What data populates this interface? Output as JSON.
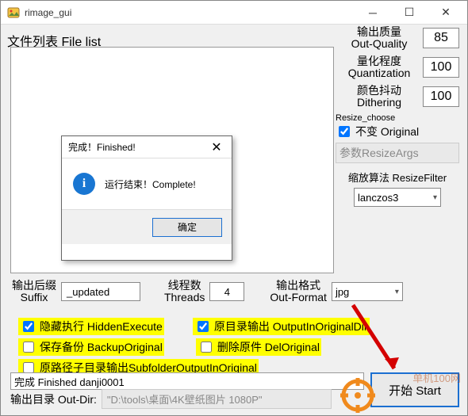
{
  "window": {
    "title": "rimage_gui"
  },
  "labels": {
    "file_list": "文件列表 File list",
    "out_quality": "输出质量\nOut-Quality",
    "quantization": "量化程度\nQuantization",
    "dithering": "颜色抖动\nDithering",
    "resize_choose": "Resize_choose",
    "original": "不变 Original",
    "resize_args": "参数ResizeArgs",
    "resize_filter": "缩放算法 ResizeFilter",
    "suffix": "输出后缀\nSuffix",
    "threads": "线程数\nThreads",
    "out_format": "输出格式\nOut-Format",
    "out_dir": "输出目录 Out-Dir:"
  },
  "values": {
    "quality": "85",
    "quantization": "100",
    "dithering": "100",
    "filter": "lanczos3",
    "suffix": "_updated",
    "threads": "4",
    "format": "jpg",
    "status": "完成 Finished  danji0001",
    "outdir_path": "\"D:\\tools\\桌面\\4K壁纸图片 1080P\""
  },
  "checks": {
    "hidden_execute": "隐藏执行 HiddenExecute",
    "output_in_original_dir": "原目录输出 OutputInOriginalDir",
    "backup_original": "保存备份 BackupOriginal",
    "del_original": "删除原件 DelOriginal",
    "subfolder_output": "原路径子目录输出SubfolderOutputInOriginal"
  },
  "buttons": {
    "start": "开始 Start",
    "ok": "确定"
  },
  "dialog": {
    "title": "完成！Finished!",
    "message": "运行结束！Complete!"
  },
  "watermark": "单机100网"
}
